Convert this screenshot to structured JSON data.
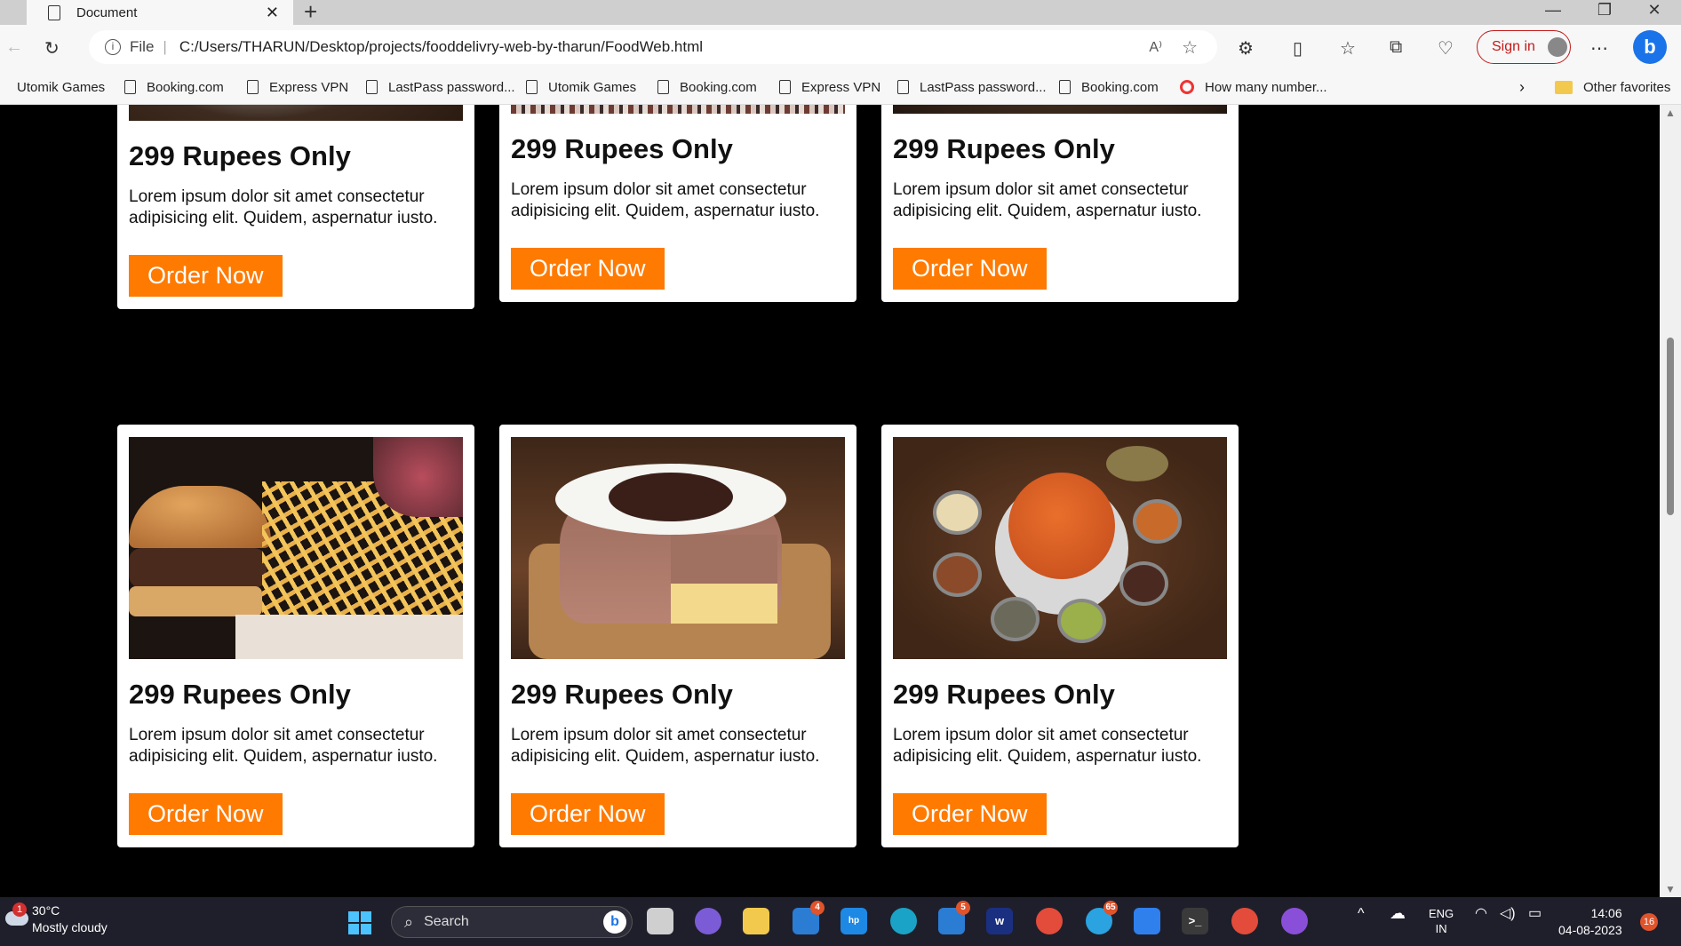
{
  "browser": {
    "tab_title": "Document",
    "address_prefix": "File",
    "url": "C:/Users/THARUN/Desktop/projects/fooddelivry-web-by-tharun/FoodWeb.html",
    "sign_in": "Sign in"
  },
  "bookmarks": {
    "items": [
      "Utomik Games",
      "Booking.com",
      "Express VPN",
      "LastPass password...",
      "Utomik Games",
      "Booking.com",
      "Express VPN",
      "LastPass password...",
      "Booking.com",
      "How many number..."
    ],
    "other": "Other favorites"
  },
  "cards": [
    {
      "price": "299 Rupees Only",
      "desc": "Lorem ipsum dolor sit amet consectetur adipisicing elit. Quidem, aspernatur iusto.",
      "button": "Order Now",
      "image": "plate-top"
    },
    {
      "price": "299 Rupees Only",
      "desc": "Lorem ipsum dolor sit amet consectetur adipisicing elit. Quidem, aspernatur iusto.",
      "button": "Order Now",
      "image": "tablecloth-top"
    },
    {
      "price": "299 Rupees Only",
      "desc": "Lorem ipsum dolor sit amet consectetur adipisicing elit. Quidem, aspernatur iusto.",
      "button": "Order Now",
      "image": "salad-top"
    },
    {
      "price": "299 Rupees Only",
      "desc": "Lorem ipsum dolor sit amet consectetur adipisicing elit. Quidem, aspernatur iusto.",
      "button": "Order Now",
      "image": "burger-fries"
    },
    {
      "price": "299 Rupees Only",
      "desc": "Lorem ipsum dolor sit amet consectetur adipisicing elit. Quidem, aspernatur iusto.",
      "button": "Order Now",
      "image": "chocolate-cake"
    },
    {
      "price": "299 Rupees Only",
      "desc": "Lorem ipsum dolor sit amet consectetur adipisicing elit. Quidem, aspernatur iusto.",
      "button": "Order Now",
      "image": "biryani-spices"
    }
  ],
  "taskbar": {
    "weather_temp": "30°C",
    "weather_desc": "Mostly cloudy",
    "weather_badge": "1",
    "search_placeholder": "Search",
    "mail_badge": "4",
    "store_badge": "5",
    "telegram_badge": "65",
    "language": "ENG",
    "region": "IN",
    "time": "14:06",
    "date": "04-08-2023",
    "notifications": "16"
  },
  "colors": {
    "accent_button": "#ff7a00",
    "page_background": "#000000",
    "card_background": "#ffffff",
    "sign_in": "#c21a1a"
  }
}
